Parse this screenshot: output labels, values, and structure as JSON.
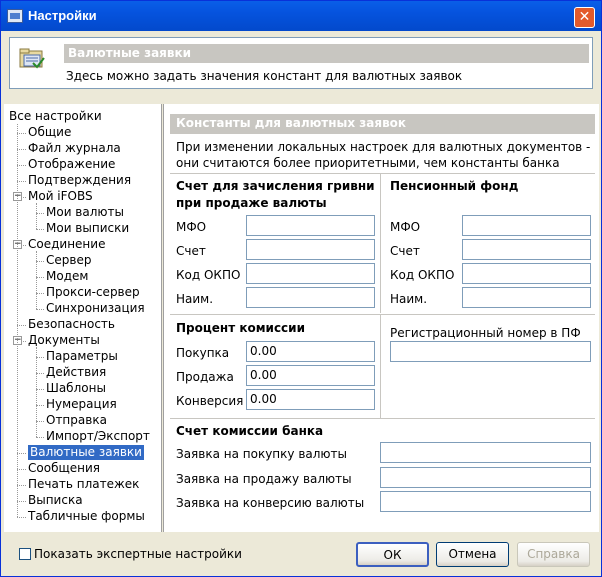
{
  "window": {
    "title": "Настройки",
    "close_glyph": "✕"
  },
  "header": {
    "title": "Валютные заявки",
    "description": "Здесь можно задать значения констант для валютных заявок"
  },
  "tree": [
    {
      "label": "Все настройки",
      "level": 0
    },
    {
      "label": "Общие",
      "level": 1
    },
    {
      "label": "Файл журнала",
      "level": 1
    },
    {
      "label": "Отображение",
      "level": 1
    },
    {
      "label": "Подтверждения",
      "level": 1
    },
    {
      "label": "Мой iFOBS",
      "level": 1,
      "expander": "−"
    },
    {
      "label": "Мои валюты",
      "level": 2
    },
    {
      "label": "Мои выписки",
      "level": 2
    },
    {
      "label": "Соединение",
      "level": 1,
      "expander": "−"
    },
    {
      "label": "Сервер",
      "level": 2
    },
    {
      "label": "Модем",
      "level": 2
    },
    {
      "label": "Прокси-сервер",
      "level": 2
    },
    {
      "label": "Синхронизация",
      "level": 2
    },
    {
      "label": "Безопасность",
      "level": 1
    },
    {
      "label": "Документы",
      "level": 1,
      "expander": "−"
    },
    {
      "label": "Параметры",
      "level": 2
    },
    {
      "label": "Действия",
      "level": 2
    },
    {
      "label": "Шаблоны",
      "level": 2
    },
    {
      "label": "Нумерация",
      "level": 2
    },
    {
      "label": "Отправка",
      "level": 2
    },
    {
      "label": "Импорт/Экспорт",
      "level": 2
    },
    {
      "label": "Валютные заявки",
      "level": 1,
      "selected": true
    },
    {
      "label": "Сообщения",
      "level": 1
    },
    {
      "label": "Печать платежек",
      "level": 1
    },
    {
      "label": "Выписка",
      "level": 1
    },
    {
      "label": "Табличные формы",
      "level": 1
    }
  ],
  "panel": {
    "section_title": "Константы для валютных заявок",
    "hint": "При изменении локальных настроек для валютных документов - они считаются более приоритетными, чем константы банка",
    "account_group": {
      "title": "Счет для зачисления гривни при продаже валюты",
      "fields": [
        {
          "label": "МФО",
          "value": ""
        },
        {
          "label": "Счет",
          "value": ""
        },
        {
          "label": "Код ОКПО",
          "value": ""
        },
        {
          "label": "Наим.",
          "value": ""
        }
      ]
    },
    "pension_group": {
      "title": "Пенсионный фонд",
      "fields": [
        {
          "label": "МФО",
          "value": ""
        },
        {
          "label": "Счет",
          "value": ""
        },
        {
          "label": "Код ОКПО",
          "value": ""
        },
        {
          "label": "Наим.",
          "value": ""
        }
      ]
    },
    "commission_group": {
      "title": "Процент комиссии",
      "fields": [
        {
          "label": "Покупка",
          "value": "0.00"
        },
        {
          "label": "Продажа",
          "value": "0.00"
        },
        {
          "label": "Конверсия",
          "value": "0.00"
        }
      ]
    },
    "pf_reg": {
      "label": "Регистрационный номер в ПФ",
      "value": ""
    },
    "bank_commission": {
      "title": "Счет комиссии банка",
      "fields": [
        {
          "label": "Заявка на покупку валюты",
          "value": ""
        },
        {
          "label": "Заявка на продажу валюты",
          "value": ""
        },
        {
          "label": "Заявка на конверсию валюты",
          "value": ""
        }
      ]
    }
  },
  "footer": {
    "expert_checkbox_label": "Показать экспертные настройки",
    "expert_checked": false,
    "ok_label": "ОК",
    "cancel_label": "Отмена",
    "help_label": "Справка"
  }
}
